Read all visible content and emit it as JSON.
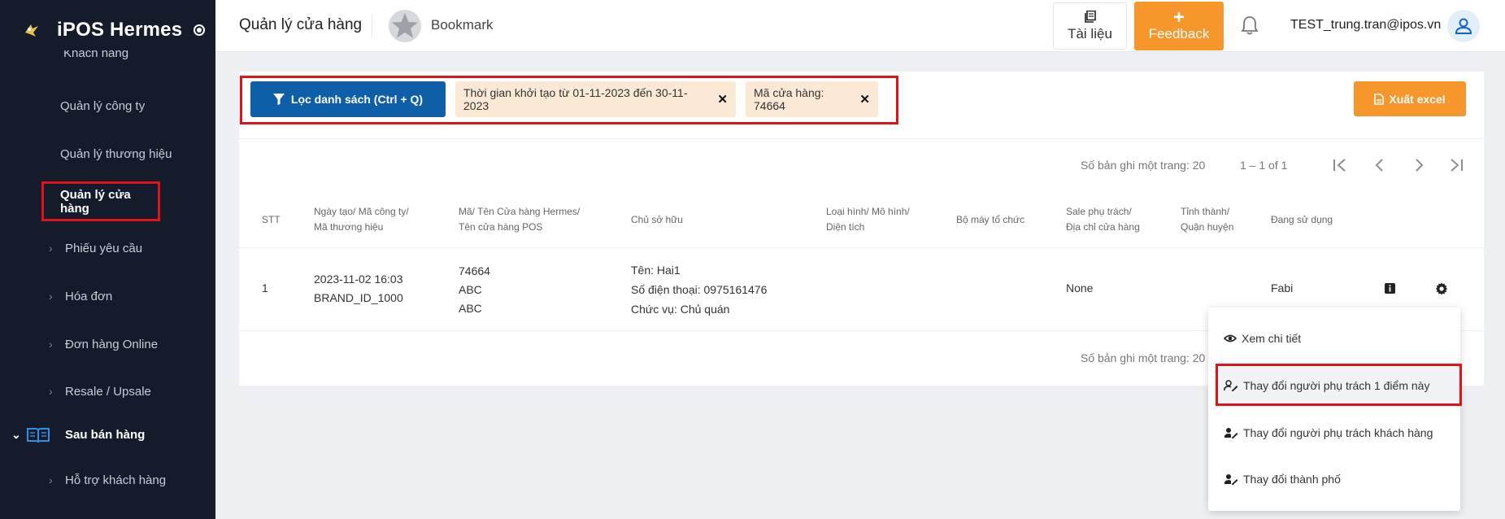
{
  "sidebar": {
    "brand": "iPOS Hermes",
    "cut_item": "Khách hàng",
    "items": [
      {
        "label": "Quản lý công ty"
      },
      {
        "label": "Quản lý thương hiệu"
      },
      {
        "label": "Quản lý cửa hàng"
      },
      {
        "label": "Phiếu yêu cầu"
      },
      {
        "label": "Hóa đơn"
      },
      {
        "label": "Đơn hàng Online"
      },
      {
        "label": "Resale / Upsale"
      },
      {
        "label": "Sau bán hàng"
      },
      {
        "label": "Hỗ trợ khách hàng"
      }
    ]
  },
  "header": {
    "title": "Quản lý cửa hàng",
    "bookmark": "Bookmark",
    "docs": "Tài liệu",
    "feedback": "Feedback",
    "user": "TEST_trung.tran@ipos.vn"
  },
  "filters": {
    "filter_button": "Lọc danh sách (Ctrl + Q)",
    "chip1": "Thời gian khởi tạo từ 01-11-2023 đến 30-11-2023",
    "chip2": "Mã cửa hàng: 74664",
    "excel": "Xuất excel"
  },
  "pagination": {
    "per_page": "Số bản ghi một trang: 20",
    "range": "1 – 1 of 1",
    "per_page_bottom": "Số bản ghi một trang: 20"
  },
  "table": {
    "headers": {
      "stt": "STT",
      "created_1": "Ngày tạo/ Mã công ty/",
      "created_2": "Mã thương hiệu",
      "store_1": "Mã/ Tên Cửa hàng Hermes/",
      "store_2": "Tên cửa hàng POS",
      "owner": "Chủ sở hữu",
      "type_1": "Loại hình/ Mô hình/",
      "type_2": "Diện tích",
      "org": "Bộ máy tổ chức",
      "sale_1": "Sale phụ trách/",
      "sale_2": "Địa chỉ cửa hàng",
      "city_1": "Tỉnh thành/",
      "city_2": "Quận huyện",
      "using": "Đang sử dụng"
    },
    "row": {
      "stt": "1",
      "date": "2023-11-02 16:03",
      "brand_id": "BRAND_ID_1000",
      "store_code": "74664",
      "store_name": "ABC",
      "pos_name": "ABC",
      "owner_name": "Tên: Hai1",
      "owner_phone": "Số điện thoại: 0975161476",
      "owner_role": "Chức vụ: Chủ quán",
      "sale": "None",
      "using": "Fabi"
    }
  },
  "menu": {
    "view": "Xem chi tiết",
    "change_point": "Thay đổi người phụ trách 1 điểm này",
    "change_customer": "Thay đổi người phụ trách khách hàng",
    "change_city": "Thay đổi thành phố"
  },
  "colors": {
    "sidebar_bg": "#141c2b",
    "primary": "#0f5ea8",
    "accent_orange": "#f7962a",
    "chip_bg": "#fbe9d5",
    "highlight_red": "#e0121a"
  }
}
